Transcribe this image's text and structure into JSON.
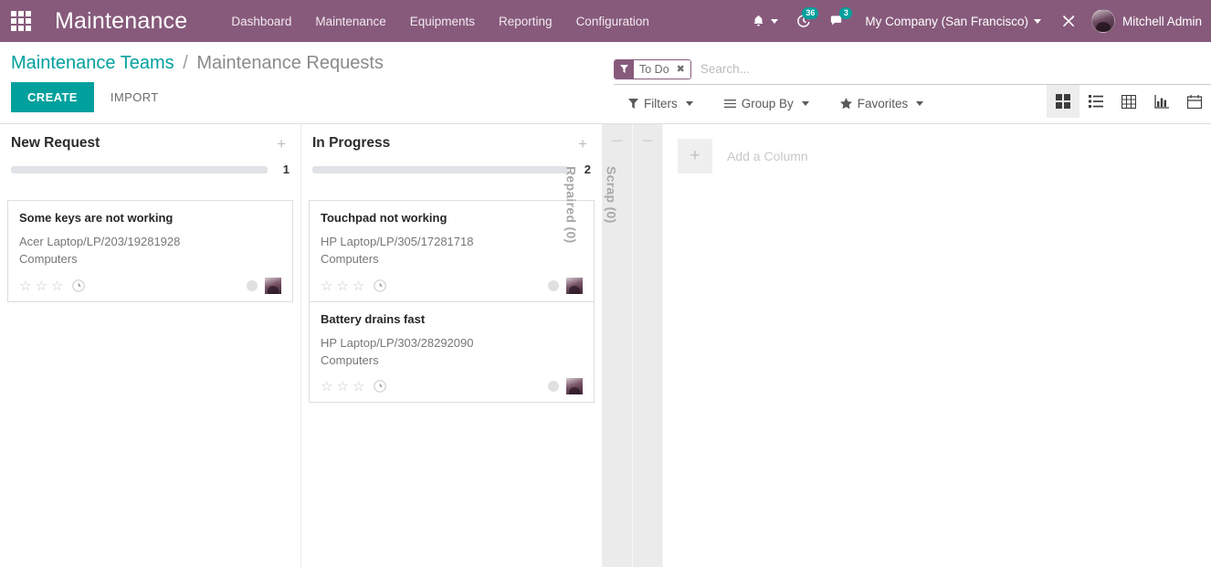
{
  "navbar": {
    "apps_icon": "grid-apps-icon",
    "brand": "Maintenance",
    "menu": [
      {
        "label": "Dashboard"
      },
      {
        "label": "Maintenance"
      },
      {
        "label": "Equipments"
      },
      {
        "label": "Reporting"
      },
      {
        "label": "Configuration"
      }
    ],
    "bell_icon": "bell-icon",
    "activity_icon": "clock-activity-icon",
    "activity_count": "36",
    "messages_icon": "chat-bubble-icon",
    "messages_count": "3",
    "company": "My Company (San Francisco)",
    "debug_icon": "wrench-tools-icon",
    "user_name": "Mitchell Admin",
    "avatar_icon": "user-avatar"
  },
  "control_panel": {
    "breadcrumb_root": "Maintenance Teams",
    "breadcrumb_sep": "/",
    "breadcrumb_current": "Maintenance Requests",
    "create_label": "CREATE",
    "import_label": "IMPORT",
    "search": {
      "facet_label": "To Do",
      "facet_icon": "filter-funnel-icon",
      "facet_remove_icon": "close-x-icon",
      "placeholder": "Search..."
    },
    "filters": [
      {
        "label": "Filters",
        "icon": "filter-funnel-icon"
      },
      {
        "label": "Group By",
        "icon": "hamburger-lines-icon"
      },
      {
        "label": "Favorites",
        "icon": "star-icon"
      }
    ],
    "views": [
      {
        "name": "kanban-view",
        "icon": "kanban-squares-icon",
        "active": true
      },
      {
        "name": "list-view",
        "icon": "list-icon",
        "active": false
      },
      {
        "name": "pivot-view",
        "icon": "table-grid-icon",
        "active": false
      },
      {
        "name": "graph-view",
        "icon": "bar-chart-icon",
        "active": false
      },
      {
        "name": "calendar-view",
        "icon": "calendar-icon",
        "active": false
      }
    ]
  },
  "kanban": {
    "columns": [
      {
        "title": "New Request",
        "count": "1",
        "add_icon": "plus-icon",
        "cards": [
          {
            "title": "Some keys are not working",
            "equipment": "Acer Laptop/LP/203/19281928",
            "category": "Computers",
            "priority_stars": 3,
            "priority_filled": 0,
            "clock_icon": "clock-icon",
            "activity_dot": "activity-state-dot",
            "avatar_icon": "assignee-avatar"
          }
        ]
      },
      {
        "title": "In Progress",
        "count": "2",
        "add_icon": "plus-icon",
        "cards": [
          {
            "title": "Touchpad not working",
            "equipment": "HP Laptop/LP/305/17281718",
            "category": "Computers",
            "priority_stars": 3,
            "priority_filled": 0,
            "clock_icon": "clock-icon",
            "activity_dot": "activity-state-dot",
            "avatar_icon": "assignee-avatar"
          },
          {
            "title": "Battery drains fast",
            "equipment": "HP Laptop/LP/303/28292090",
            "category": "Computers",
            "priority_stars": 3,
            "priority_filled": 0,
            "clock_icon": "clock-icon",
            "activity_dot": "activity-state-dot",
            "avatar_icon": "assignee-avatar"
          }
        ]
      }
    ],
    "folded_columns": [
      {
        "label": "Repaired (0)",
        "toggle_icon": "minus-icon"
      },
      {
        "label": "Scrap (0)",
        "toggle_icon": "minus-icon"
      }
    ],
    "add_column_label": "Add a Column",
    "add_column_icon": "plus-icon"
  },
  "colors": {
    "brand_purple": "#875A7B",
    "accent_teal": "#00A09D",
    "text_dark": "#2b2b2b",
    "muted": "#8a8a8a"
  }
}
